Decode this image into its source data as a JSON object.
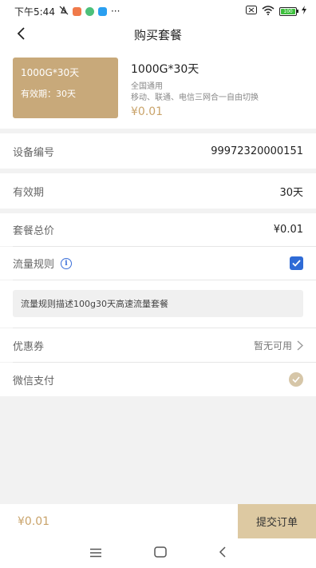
{
  "status": {
    "time": "下午5:44",
    "battery_level": "100",
    "more": "···"
  },
  "nav": {
    "title": "购买套餐"
  },
  "product": {
    "image_title": "1000G*30天",
    "image_validity": "有效期：30天",
    "name": "1000G*30天",
    "desc_line1": "全国通用",
    "desc_line2": "移动、联通、电信三网合一自由切换",
    "price": "¥0.01"
  },
  "device": {
    "label": "设备编号",
    "value": "99972320000151"
  },
  "validity": {
    "label": "有效期",
    "value": "30天"
  },
  "total": {
    "label": "套餐总价",
    "value": "¥0.01"
  },
  "traffic_rule": {
    "label": "流量规则",
    "checked": true,
    "description": "流量规则描述100g30天高速流量套餐"
  },
  "coupon": {
    "label": "优惠券",
    "value": "暂无可用"
  },
  "payment": {
    "label": "微信支付",
    "selected": true
  },
  "footer": {
    "price": "¥0.01",
    "submit_label": "提交订单"
  },
  "colors": {
    "accent": "#c9a36a",
    "product_bg": "#c8a97a",
    "checkbox": "#2f6bd6",
    "submit_bg": "#ddc9a2"
  }
}
